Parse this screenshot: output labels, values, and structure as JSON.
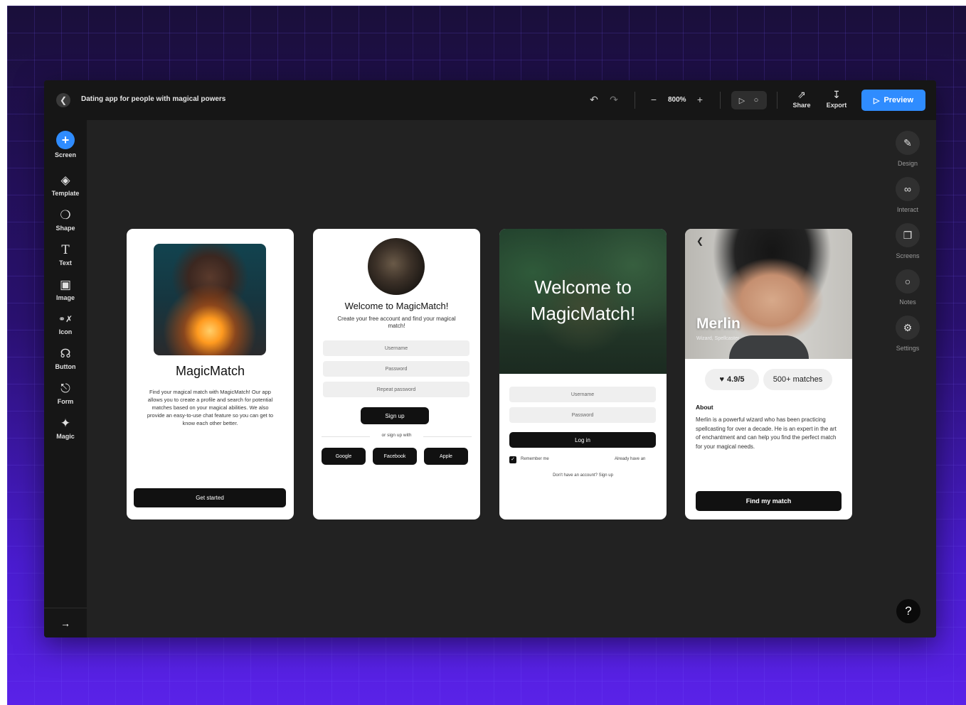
{
  "header": {
    "back_icon": "chevron-left-icon",
    "title": "Dating app for people with magical powers",
    "zoom": "800%",
    "share_label": "Share",
    "export_label": "Export",
    "preview_label": "Preview"
  },
  "left_rail": {
    "items": [
      {
        "label": "Screen",
        "icon": "plus-icon"
      },
      {
        "label": "Template",
        "icon": "layers-icon"
      },
      {
        "label": "Shape",
        "icon": "shapes-icon"
      },
      {
        "label": "Text",
        "icon": "text-icon"
      },
      {
        "label": "Image",
        "icon": "image-icon"
      },
      {
        "label": "Icon",
        "icon": "icon-grid-icon"
      },
      {
        "label": "Button",
        "icon": "button-icon"
      },
      {
        "label": "Form",
        "icon": "form-icon"
      },
      {
        "label": "Magic",
        "icon": "magic-wand-icon"
      }
    ]
  },
  "right_rail": {
    "items": [
      {
        "label": "Design",
        "icon": "pencil-icon"
      },
      {
        "label": "Interact",
        "icon": "link-icon"
      },
      {
        "label": "Screens",
        "icon": "screens-icon"
      },
      {
        "label": "Notes",
        "icon": "note-icon"
      },
      {
        "label": "Settings",
        "icon": "gear-icon"
      }
    ]
  },
  "help_label": "?",
  "screens": {
    "s1": {
      "title": "MagicMatch",
      "body": "Find your magical match with MagicMatch! Our app allows you to create a profile and search for potential matches based on your magical abilities. We also provide an easy-to-use chat feature so you can get to know each other better.",
      "cta": "Get started"
    },
    "s2": {
      "title": "Welcome to MagicMatch!",
      "subtitle": "Create your free account and find your magical match!",
      "fields": [
        "Username",
        "Password",
        "Repeat password"
      ],
      "signup": "Sign up",
      "or": "or sign up with",
      "social": [
        "Google",
        "Facebook",
        "Apple"
      ]
    },
    "s3": {
      "title": "Welcome to MagicMatch!",
      "fields": [
        "Username",
        "Password"
      ],
      "login": "Log in",
      "remember": "Remember me",
      "already": "Already have an",
      "signup_link": "Don't have an account? Sign up"
    },
    "s4": {
      "name": "Merlin",
      "role": "Wizard, Spellcaster",
      "rating": "4.9/5",
      "matches": "500+ matches",
      "about_heading": "About",
      "bio": "Merlin is a powerful wizard who has been practicing spellcasting for over a decade. He is an expert in the art of enchantment and can help you find the perfect match for your magical needs.",
      "cta": "Find my match"
    }
  }
}
